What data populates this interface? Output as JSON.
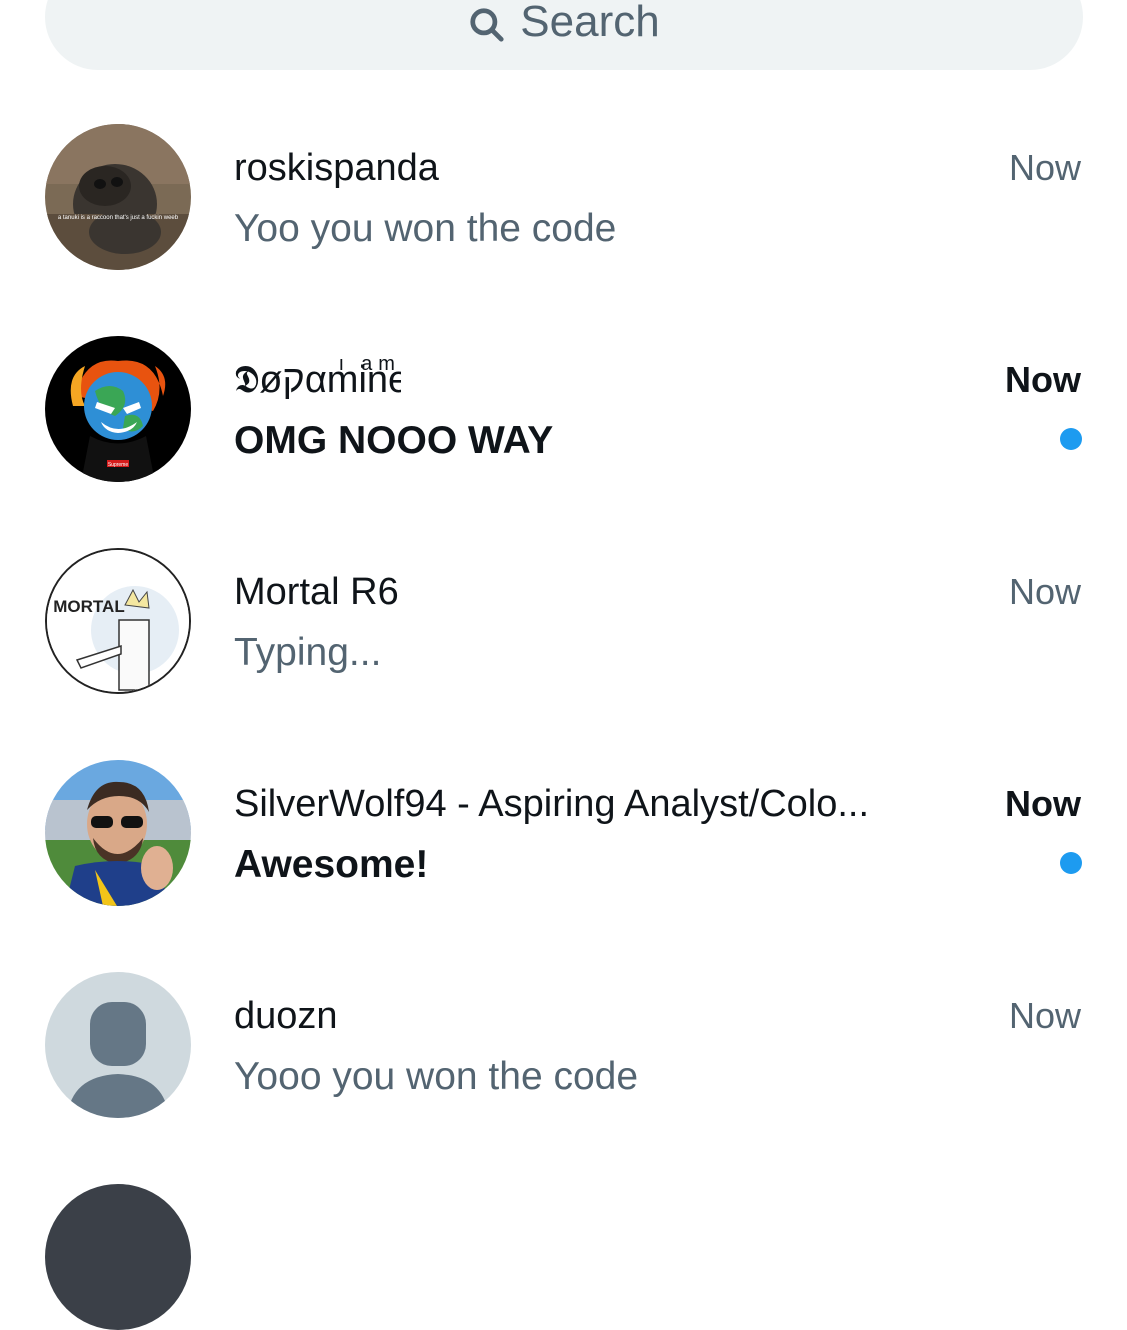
{
  "search": {
    "label": "Search",
    "icon": "search-icon"
  },
  "colors": {
    "accent": "#1d9bf0",
    "muted": "#536471",
    "text": "#0f1419",
    "search_bg": "#eff3f4"
  },
  "conversations": [
    {
      "name": "roskispanda",
      "time": "Now",
      "preview": "Yoo you won the code",
      "unread": false,
      "avatar_caption": "a tanuki is a raccoon that's just a fuckin weeb"
    },
    {
      "name": "𝕯𝖔𝖕𝖆𝖒𝖎𝖓𝖊",
      "name_display": "𝕯øקαmine",
      "name_small": "i am",
      "time": "Now",
      "preview": "OMG NOOO WAY",
      "unread": true,
      "avatar_caption": "Supreme"
    },
    {
      "name": "Mortal R6",
      "time": "Now",
      "preview": "Typing...",
      "unread": false,
      "avatar_caption": "MORTAL"
    },
    {
      "name": "SilverWolf94 - Aspiring Analyst/Colo...",
      "time": "Now",
      "preview": "Awesome!",
      "unread": true
    },
    {
      "name": "duozn",
      "time": "Now",
      "preview": "Yooo you won the code",
      "unread": false
    }
  ]
}
